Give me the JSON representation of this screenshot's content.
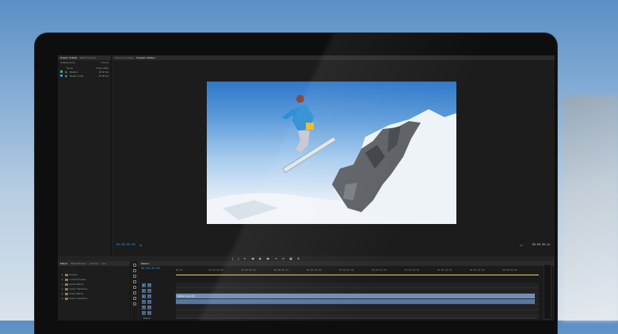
{
  "project": {
    "tabs": [
      "Project: Untitled",
      "Effect Controls"
    ],
    "file": "Untitled.prproj",
    "count": "2 Items",
    "col_name": "Name",
    "col_rate": "Frame Rate",
    "items": [
      {
        "name": "Media 1",
        "rate": "25.00 fps",
        "color": "#3fb35f"
      },
      {
        "name": "Media 1.mp4",
        "rate": "25.00 fps",
        "color": "#4b8fd9"
      }
    ]
  },
  "monitor": {
    "tabs": [
      "Source: (no clips)",
      "Program: Media 1"
    ],
    "timecode_left": "00:00:00:00",
    "fit": "Fit",
    "ratio": "1/2",
    "timecode_right": "00:00:00:14"
  },
  "transport": [
    "◀",
    "{",
    "}",
    "⇤",
    "◀I",
    "▶",
    "I▶",
    "⇥",
    "⇴",
    "▣",
    "⊕"
  ],
  "effects": {
    "tabs": [
      "Effects",
      "Media Browser",
      "Libraries",
      "Info"
    ],
    "folders": [
      "Presets",
      "Lumetri Presets",
      "Audio Effects",
      "Audio Transitions",
      "Video Effects",
      "Video Transitions"
    ]
  },
  "timeline": {
    "tab": "Media 1",
    "timecode": "00:00:00:00",
    "ruler": [
      "00:00",
      "00:00:00:05",
      "00:00:00:10",
      "00:00:00:15",
      "00:00:00:20",
      "00:00:01:00",
      "00:00:01:05",
      "00:00:01:10",
      "00:00:01:15",
      "00:00:01:20",
      "00:00:02:00"
    ],
    "tracks": [
      {
        "label": "V3"
      },
      {
        "label": "V2"
      },
      {
        "label": "V1",
        "clip": "Media 1.mp4 [V]"
      },
      {
        "label": "A1",
        "clip": " "
      },
      {
        "label": "A2"
      },
      {
        "label": "A3"
      }
    ],
    "master": "Master"
  }
}
